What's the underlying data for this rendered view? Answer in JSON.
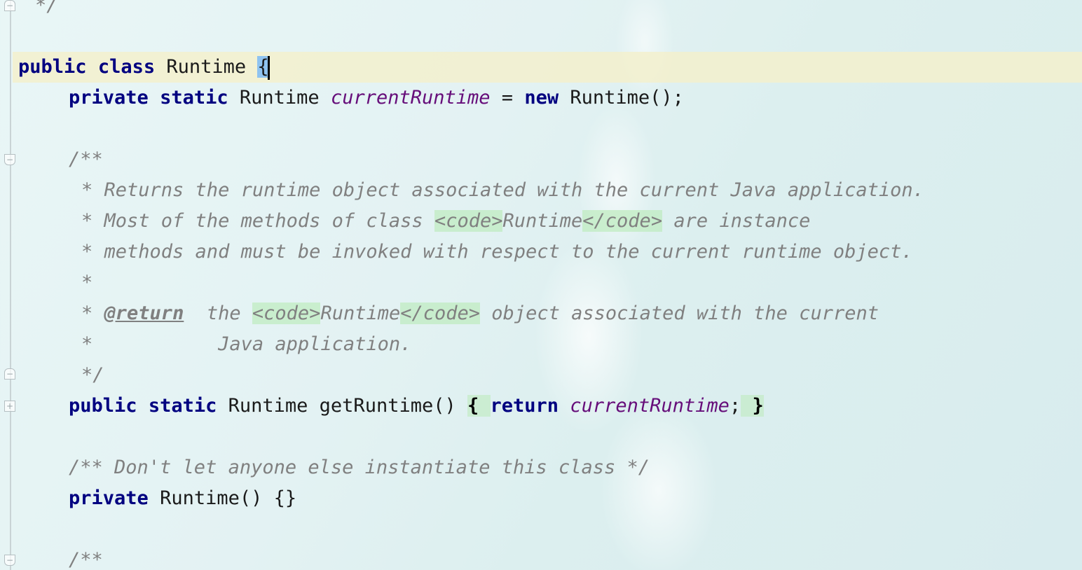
{
  "editor": {
    "lines": {
      "l0": "*/",
      "l1_kw1": "public",
      "l1_kw2": "class",
      "l1_name": "Runtime",
      "l1_brace": "{",
      "l2_kw1": "private",
      "l2_kw2": "static",
      "l2_type": "Runtime",
      "l2_field": "currentRuntime",
      "l2_eq": "=",
      "l2_new": "new",
      "l2_call": "Runtime();",
      "l3": "/**",
      "l4": "* Returns the runtime object associated with the current Java application.",
      "l5_a": "* Most of the methods of class",
      "l5_tag1": "<code>",
      "l5_mid": "Runtime",
      "l5_tag2": "</code>",
      "l5_b": "are instance",
      "l6": "* methods and must be invoked with respect to the current runtime object.",
      "l7": "*",
      "l8_star": "*",
      "l8_tag": "@return",
      "l8_a": "the",
      "l8_tag1": "<code>",
      "l8_mid": "Runtime",
      "l8_tag2": "</code>",
      "l8_b": "object associated with the current",
      "l9": "*           Java application.",
      "l10": "*/",
      "l11_kw1": "public",
      "l11_kw2": "static",
      "l11_sig": "Runtime getRuntime()",
      "l11_ob": "{",
      "l11_ret": "return",
      "l11_field": "currentRuntime",
      "l11_semi": ";",
      "l11_cb": "}",
      "l12": "/** Don't let anyone else instantiate this class */",
      "l13_kw": "private",
      "l13_rest": "Runtime() {}",
      "l14": "/**"
    }
  },
  "colors": {
    "keyword": "#000080",
    "field": "#660e7a",
    "comment": "#808080",
    "current_line": "#f3f0cd",
    "brace_match": "#8fc3f0"
  },
  "icons": [
    "fold-collapse-icon",
    "fold-expand-icon",
    "fold-end-icon"
  ]
}
